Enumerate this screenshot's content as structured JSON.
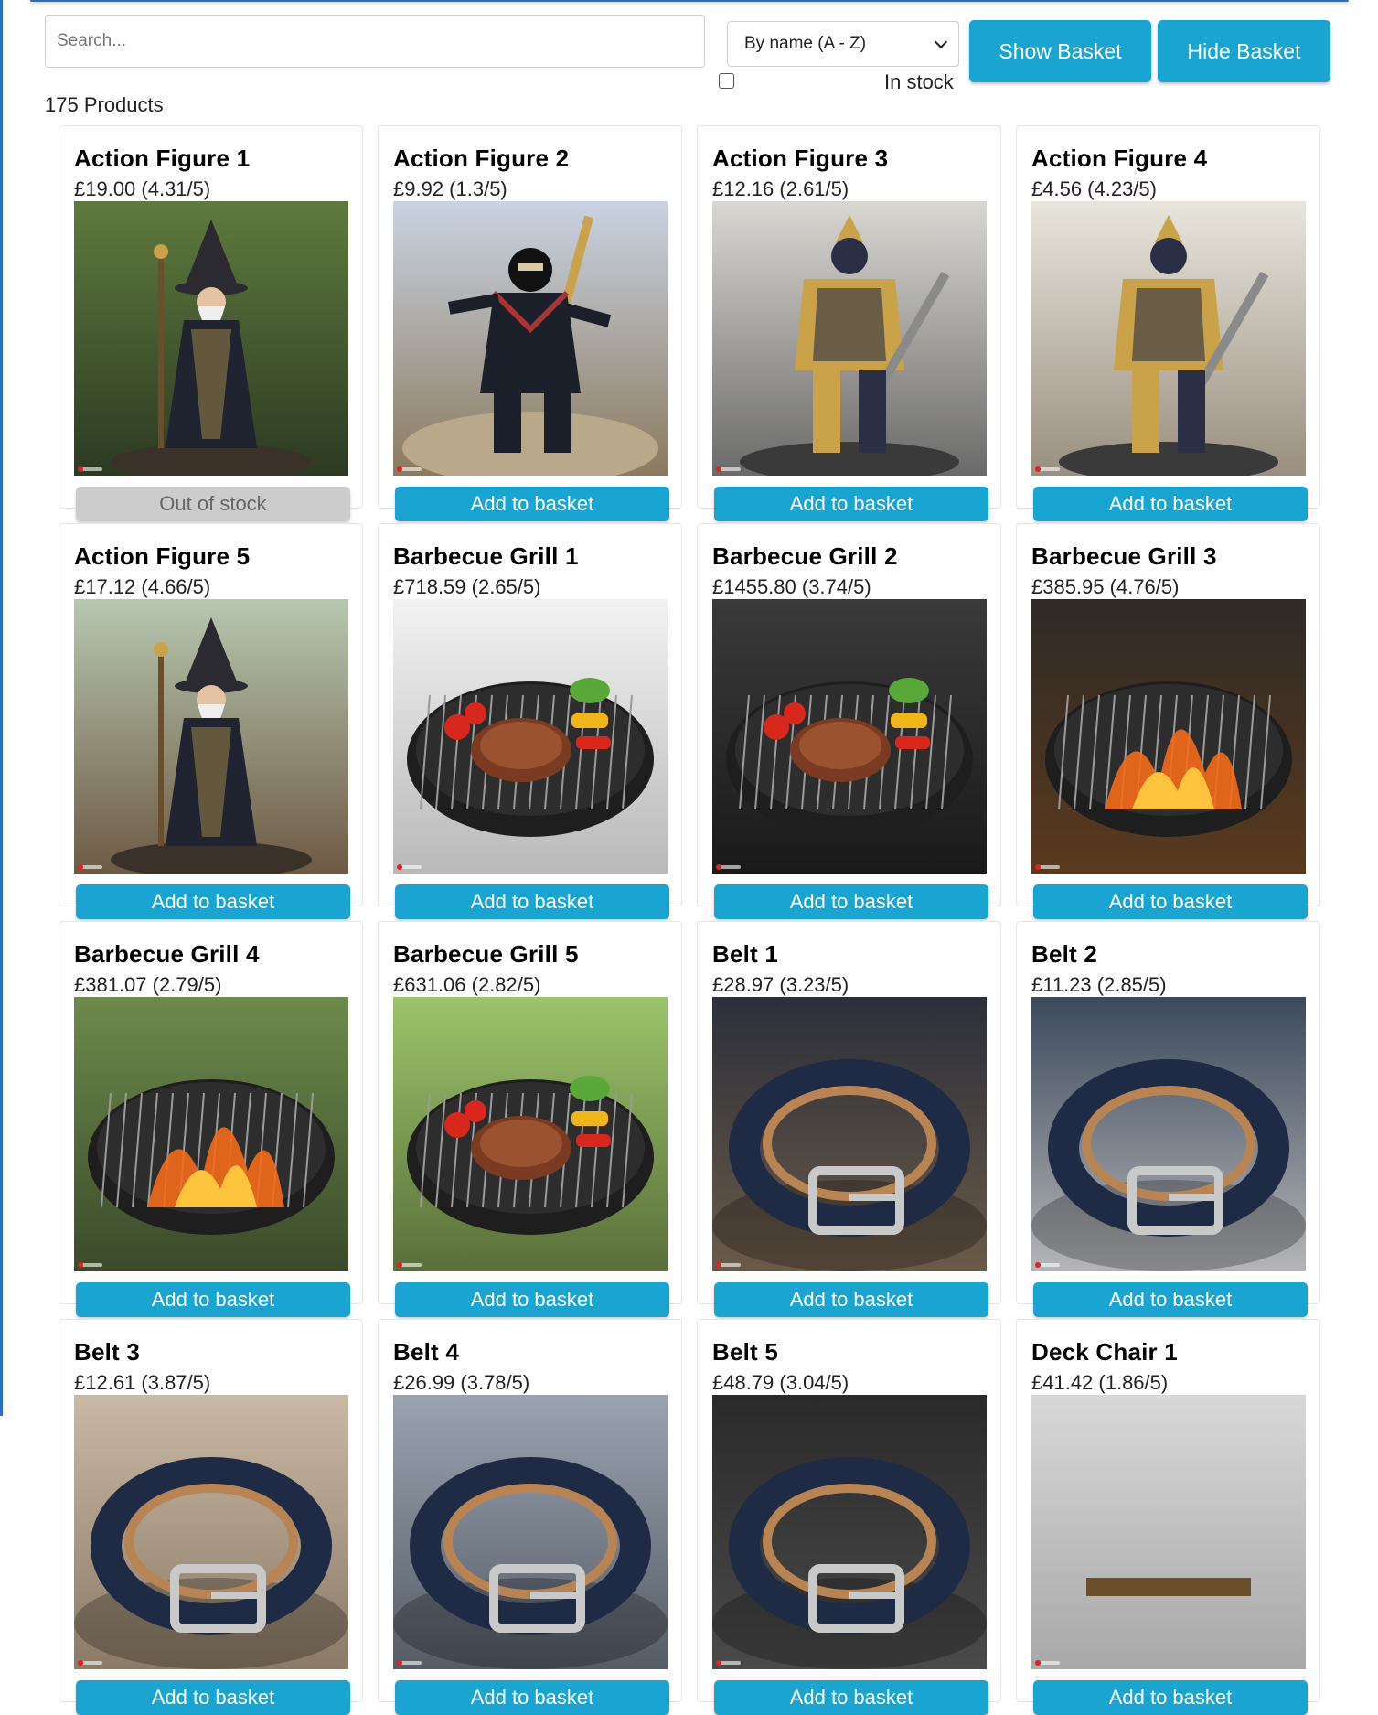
{
  "search": {
    "placeholder": "Search..."
  },
  "sort": {
    "selected": "By name (A - Z)"
  },
  "filters": {
    "in_stock_label": "In stock"
  },
  "buttons": {
    "show_basket": "Show Basket",
    "hide_basket": "Hide Basket"
  },
  "product_count": "175 Products",
  "colors": {
    "accent": "#1aa4d1",
    "disabled": "#cccccc"
  },
  "products": [
    {
      "name": "Action Figure 1",
      "price": "£19.00 (4.31/5)",
      "button": "Out of stock",
      "in_stock": false,
      "icon": "wizard-figure"
    },
    {
      "name": "Action Figure 2",
      "price": "£9.92 (1.3/5)",
      "button": "Add to basket",
      "in_stock": true,
      "icon": "ninja-figure"
    },
    {
      "name": "Action Figure 3",
      "price": "£12.16 (2.61/5)",
      "button": "Add to basket",
      "in_stock": true,
      "icon": "warrior-figure"
    },
    {
      "name": "Action Figure 4",
      "price": "£4.56 (4.23/5)",
      "button": "Add to basket",
      "in_stock": true,
      "icon": "warrior-figure"
    },
    {
      "name": "Action Figure 5",
      "price": "£17.12 (4.66/5)",
      "button": "Add to basket",
      "in_stock": true,
      "icon": "wizard-figure"
    },
    {
      "name": "Barbecue Grill 1",
      "price": "£718.59 (2.65/5)",
      "button": "Add to basket",
      "in_stock": true,
      "icon": "grill"
    },
    {
      "name": "Barbecue Grill 2",
      "price": "£1455.80 (3.74/5)",
      "button": "Add to basket",
      "in_stock": true,
      "icon": "grill"
    },
    {
      "name": "Barbecue Grill 3",
      "price": "£385.95 (4.76/5)",
      "button": "Add to basket",
      "in_stock": true,
      "icon": "grill-fire"
    },
    {
      "name": "Barbecue Grill 4",
      "price": "£381.07 (2.79/5)",
      "button": "Add to basket",
      "in_stock": true,
      "icon": "grill-fire"
    },
    {
      "name": "Barbecue Grill 5",
      "price": "£631.06 (2.82/5)",
      "button": "Add to basket",
      "in_stock": true,
      "icon": "grill"
    },
    {
      "name": "Belt 1",
      "price": "£28.97 (3.23/5)",
      "button": "Add to basket",
      "in_stock": true,
      "icon": "belt"
    },
    {
      "name": "Belt 2",
      "price": "£11.23 (2.85/5)",
      "button": "Add to basket",
      "in_stock": true,
      "icon": "belt"
    },
    {
      "name": "Belt 3",
      "price": "£12.61 (3.87/5)",
      "button": "Add to basket",
      "in_stock": true,
      "icon": "belt"
    },
    {
      "name": "Belt 4",
      "price": "£26.99 (3.78/5)",
      "button": "Add to basket",
      "in_stock": true,
      "icon": "belt"
    },
    {
      "name": "Belt 5",
      "price": "£48.79 (3.04/5)",
      "button": "Add to basket",
      "in_stock": true,
      "icon": "belt"
    },
    {
      "name": "Deck Chair 1",
      "price": "£41.42 (1.86/5)",
      "button": "Add to basket",
      "in_stock": true,
      "icon": "deck-chair"
    }
  ]
}
